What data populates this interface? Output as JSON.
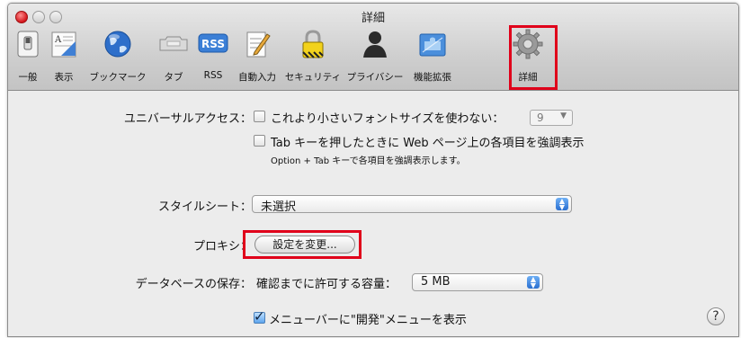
{
  "window": {
    "title": "詳細"
  },
  "toolbar": [
    {
      "label": "一般",
      "icon": "light-switch-icon"
    },
    {
      "label": "表示",
      "icon": "appearance-icon"
    },
    {
      "label": "ブックマーク",
      "icon": "globe-icon"
    },
    {
      "label": "タブ",
      "icon": "tabs-icon"
    },
    {
      "label": "RSS",
      "icon": "rss-icon"
    },
    {
      "label": "自動入力",
      "icon": "pencil-form-icon"
    },
    {
      "label": "セキュリティ",
      "icon": "padlock-icon"
    },
    {
      "label": "プライバシー",
      "icon": "person-silhouette-icon"
    },
    {
      "label": "機能拡張",
      "icon": "puzzle-icon"
    },
    {
      "label": "詳細",
      "icon": "gear-icon"
    }
  ],
  "rss_badge": "RSS",
  "accessibility": {
    "label": "ユニバーサルアクセス：",
    "font_check_label": "これより小さいフォントサイズを使わない：",
    "font_size": "9",
    "tab_check_label": "Tab キーを押したときに Web ページ上の各項目を強調表示",
    "tab_hint": "Option + Tab キーで各項目を強調表示します。"
  },
  "stylesheet": {
    "label": "スタイルシート：",
    "value": "未選択"
  },
  "proxy": {
    "label": "プロキシ：",
    "button": "設定を変更..."
  },
  "database": {
    "label": "データベースの保存：",
    "sublabel": "確認までに許可する容量：",
    "value": "5 MB"
  },
  "develop_menu": {
    "label": "メニューバーに\"開発\"メニューを表示"
  },
  "help": "?",
  "colors": {
    "highlight": "#e0001a",
    "accent": "#2a6fd0"
  }
}
